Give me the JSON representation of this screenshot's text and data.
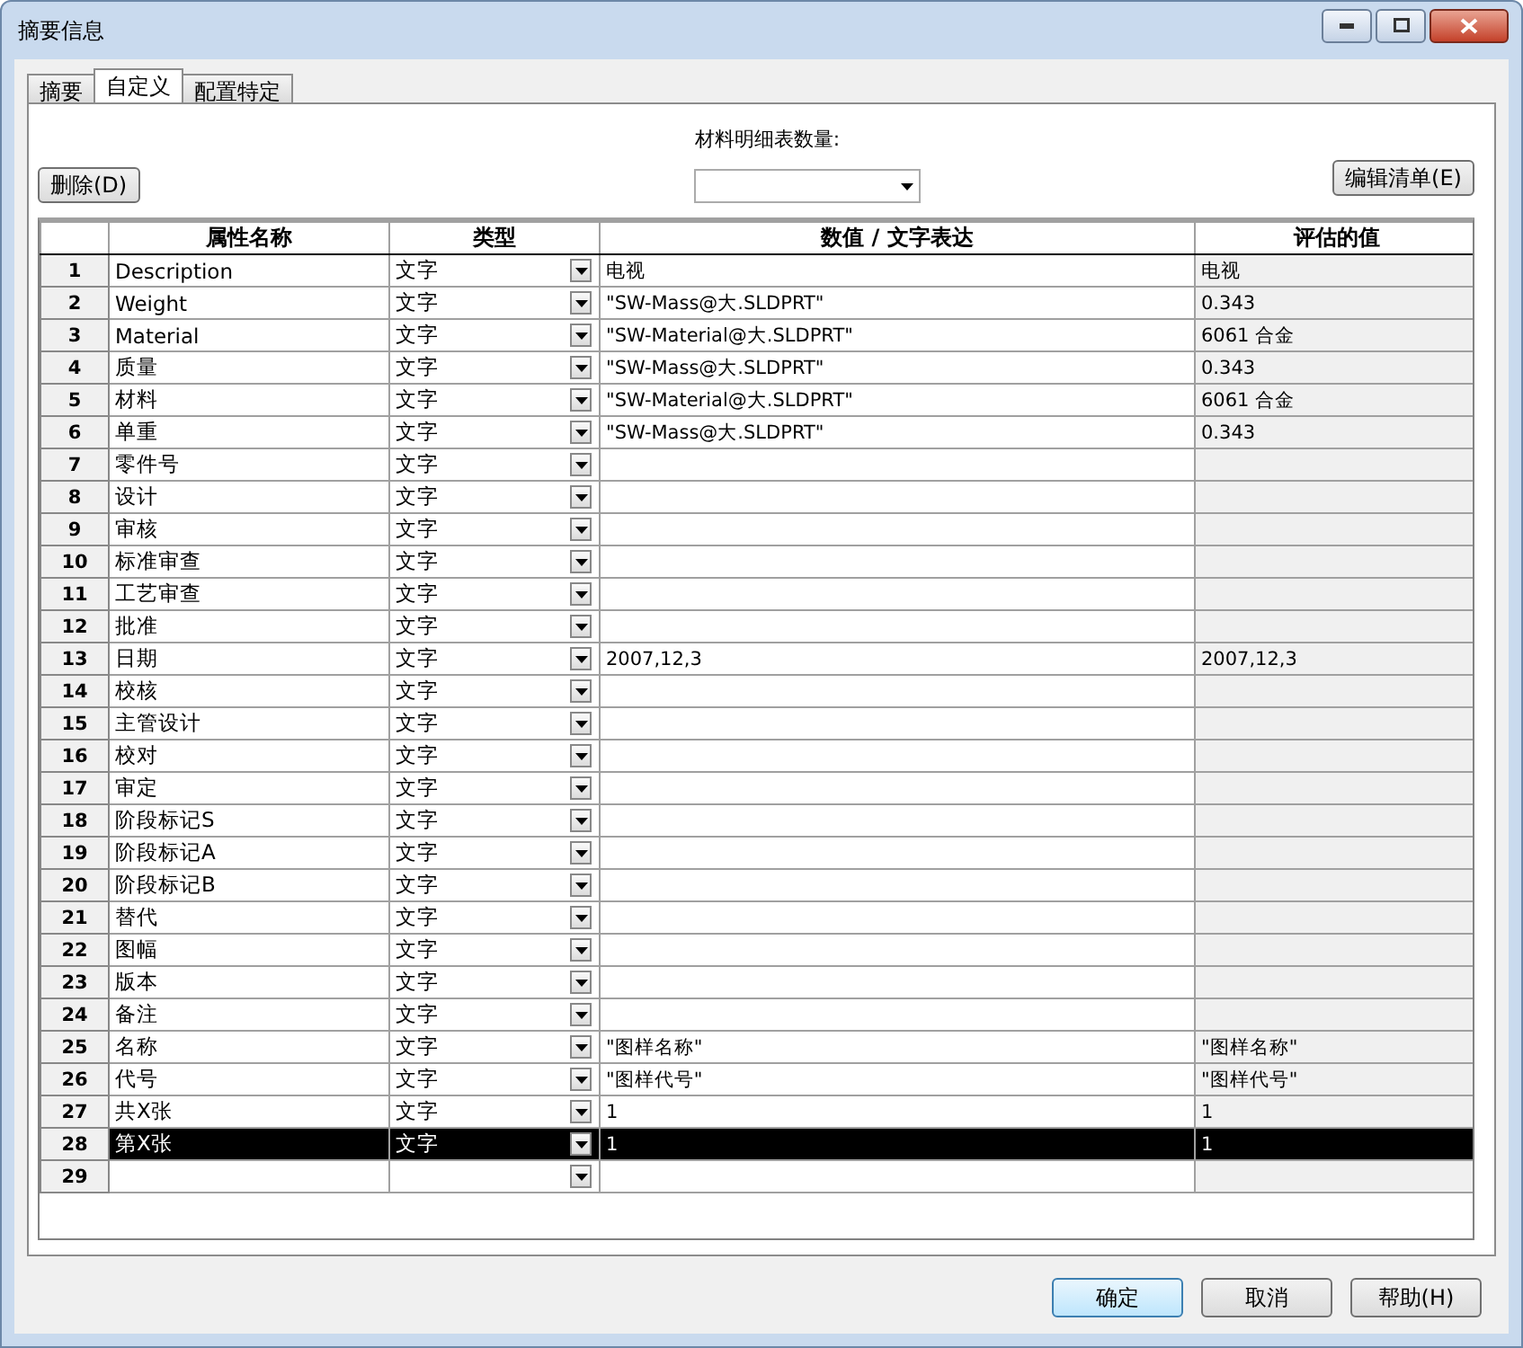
{
  "window": {
    "title": "摘要信息"
  },
  "tabs": [
    {
      "label": "摘要",
      "selected": false
    },
    {
      "label": "自定义",
      "selected": true
    },
    {
      "label": "配置特定",
      "selected": false
    }
  ],
  "delete_button": "删除(D)",
  "bom_quantity": {
    "label": "材料明细表数量:"
  },
  "edit_list_button": "编辑清单(E)",
  "table": {
    "columns": [
      "属性名称",
      "类型",
      "数值 / 文字表达",
      "评估的值"
    ],
    "rows": [
      {
        "number": "1",
        "name": "Description",
        "type": "文字",
        "value": "电视",
        "evaluated": "电视",
        "selected": false
      },
      {
        "number": "2",
        "name": "Weight",
        "type": "文字",
        "value": "\"SW-Mass@大.SLDPRT\"",
        "evaluated": "0.343",
        "selected": false
      },
      {
        "number": "3",
        "name": "Material",
        "type": "文字",
        "value": "\"SW-Material@大.SLDPRT\"",
        "evaluated": "6061 合金",
        "selected": false
      },
      {
        "number": "4",
        "name": "质量",
        "type": "文字",
        "value": "\"SW-Mass@大.SLDPRT\"",
        "evaluated": "0.343",
        "selected": false
      },
      {
        "number": "5",
        "name": "材料",
        "type": "文字",
        "value": "\"SW-Material@大.SLDPRT\"",
        "evaluated": "6061 合金",
        "selected": false
      },
      {
        "number": "6",
        "name": "单重",
        "type": "文字",
        "value": "\"SW-Mass@大.SLDPRT\"",
        "evaluated": "0.343",
        "selected": false
      },
      {
        "number": "7",
        "name": "零件号",
        "type": "文字",
        "selected": false
      },
      {
        "number": "8",
        "name": "设计",
        "type": "文字",
        "selected": false
      },
      {
        "number": "9",
        "name": "审核",
        "type": "文字",
        "selected": false
      },
      {
        "number": "10",
        "name": "标准审查",
        "type": "文字",
        "selected": false
      },
      {
        "number": "11",
        "name": "工艺审查",
        "type": "文字",
        "selected": false
      },
      {
        "number": "12",
        "name": "批准",
        "type": "文字",
        "selected": false
      },
      {
        "number": "13",
        "name": "日期",
        "type": "文字",
        "value": "2007,12,3",
        "evaluated": "2007,12,3",
        "selected": false
      },
      {
        "number": "14",
        "name": "校核",
        "type": "文字",
        "selected": false
      },
      {
        "number": "15",
        "name": "主管设计",
        "type": "文字",
        "selected": false
      },
      {
        "number": "16",
        "name": "校对",
        "type": "文字",
        "selected": false
      },
      {
        "number": "17",
        "name": "审定",
        "type": "文字",
        "selected": false
      },
      {
        "number": "18",
        "name": "阶段标记S",
        "type": "文字",
        "selected": false
      },
      {
        "number": "19",
        "name": "阶段标记A",
        "type": "文字",
        "selected": false
      },
      {
        "number": "20",
        "name": "阶段标记B",
        "type": "文字",
        "selected": false
      },
      {
        "number": "21",
        "name": "替代",
        "type": "文字",
        "selected": false
      },
      {
        "number": "22",
        "name": "图幅",
        "type": "文字",
        "selected": false
      },
      {
        "number": "23",
        "name": "版本",
        "type": "文字",
        "selected": false
      },
      {
        "number": "24",
        "name": "备注",
        "type": "文字",
        "selected": false
      },
      {
        "number": "25",
        "name": "名称",
        "type": "文字",
        "value": "\"图样名称\"",
        "evaluated": "\"图样名称\"",
        "selected": false
      },
      {
        "number": "26",
        "name": "代号",
        "type": "文字",
        "value": "\"图样代号\"",
        "evaluated": "\"图样代号\"",
        "selected": false
      },
      {
        "number": "27",
        "name": "共X张",
        "type": "文字",
        "value": "1",
        "evaluated": "1",
        "selected": false
      },
      {
        "number": "28",
        "name": "第X张",
        "type": "文字",
        "value": "1",
        "evaluated": "1",
        "selected": true
      },
      {
        "number": "29",
        "selected": false
      }
    ]
  },
  "buttons": [
    {
      "label": "确定",
      "kind": "default"
    },
    {
      "label": "取消",
      "kind": "normal"
    },
    {
      "label": "帮助(H)",
      "kind": "normal"
    }
  ]
}
